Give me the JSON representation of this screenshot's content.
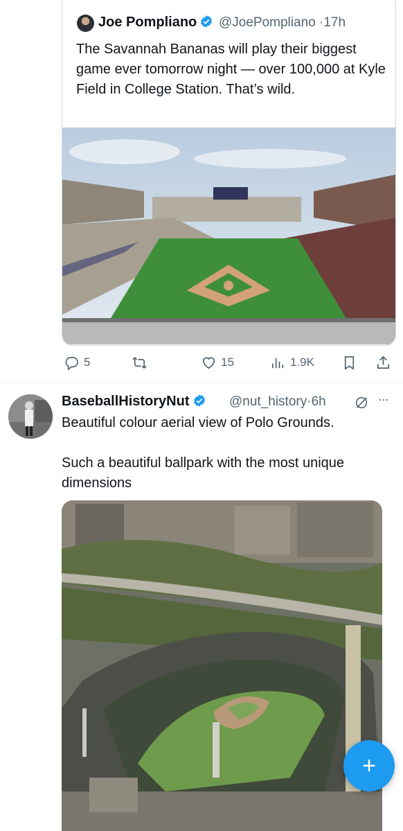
{
  "quoted_tweet": {
    "author_name": "Joe Pompliano",
    "handle": "@JoePompliano",
    "time": "17h",
    "separator": "·",
    "text": "The Savannah Bananas will play their biggest game ever tomorrow night — over 100,000 at Kyle Field in College Station. That’s wild.",
    "media_icon": "stadium-photo"
  },
  "actions": {
    "reply_count": "5",
    "repost_count": "",
    "like_count": "15",
    "views_count": "1.9K"
  },
  "tweet2": {
    "author_name": "BaseballHistoryNut",
    "handle": "@nut_history",
    "time": "6h",
    "separator": "·",
    "more_label": "···",
    "text_line1": "Beautiful colour aerial view of Polo Grounds.",
    "text_line2": "Such a beautiful ballpark with the most unique dimensions",
    "media_icon": "polo-grounds-photo"
  },
  "fab": {
    "label": "+"
  },
  "colors": {
    "accent": "#1d9bf0",
    "muted": "#536471",
    "text": "#0f1419"
  }
}
